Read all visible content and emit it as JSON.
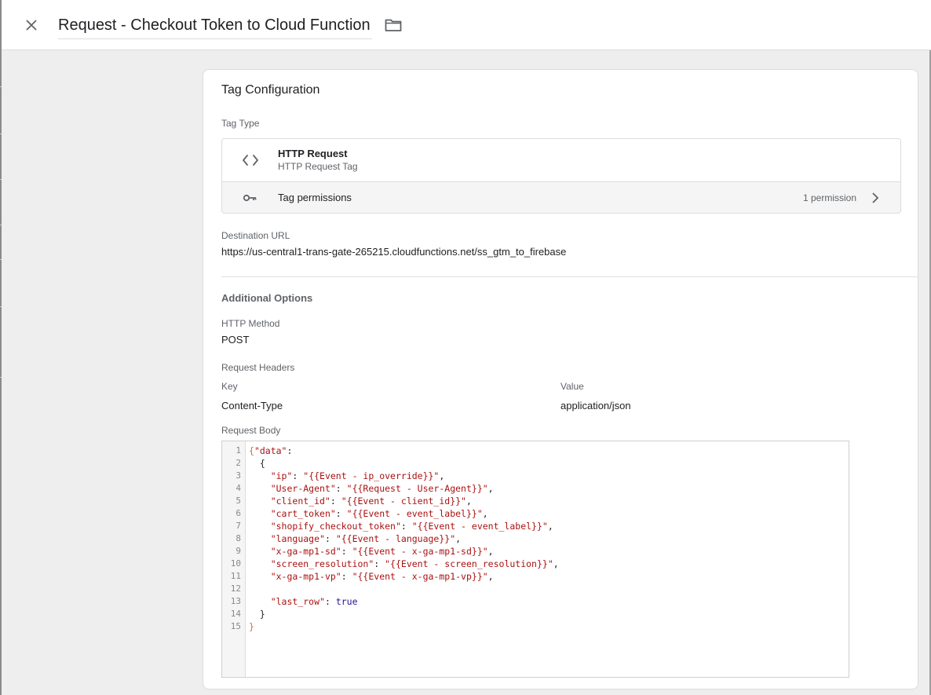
{
  "header": {
    "title": "Request - Checkout Token to Cloud Function"
  },
  "card": {
    "title": "Tag Configuration",
    "tag_type_label": "Tag Type",
    "tag_name": "HTTP Request",
    "tag_sub": "HTTP Request Tag",
    "permissions_label": "Tag permissions",
    "permissions_count": "1 permission",
    "destination_label": "Destination URL",
    "destination_value": "https://us-central1-trans-gate-265215.cloudfunctions.net/ss_gtm_to_firebase",
    "additional_options": "Additional Options",
    "http_method_label": "HTTP Method",
    "http_method_value": "POST",
    "headers_label": "Request Headers",
    "key_label": "Key",
    "value_label": "Value",
    "header_key": "Content-Type",
    "header_value": "application/json",
    "body_label": "Request Body"
  },
  "editor": {
    "line_numbers": [
      "1",
      "2",
      "3",
      "4",
      "5",
      "6",
      "7",
      "8",
      "9",
      "10",
      "11",
      "12",
      "13",
      "14",
      "15"
    ],
    "lines": [
      {
        "pre": "",
        "key": "\"data\"",
        "sep": ":",
        "val": "",
        "post": "",
        "open": "{"
      },
      {
        "pre": "  {",
        "key": "",
        "sep": "",
        "val": "",
        "post": ""
      },
      {
        "pre": "    ",
        "key": "\"ip\"",
        "sep": ": ",
        "val": "\"{{Event - ip_override}}\"",
        "post": ","
      },
      {
        "pre": "    ",
        "key": "\"User-Agent\"",
        "sep": ": ",
        "val": "\"{{Request - User-Agent}}\"",
        "post": ","
      },
      {
        "pre": "    ",
        "key": "\"client_id\"",
        "sep": ": ",
        "val": "\"{{Event - client_id}}\"",
        "post": ","
      },
      {
        "pre": "    ",
        "key": "\"cart_token\"",
        "sep": ": ",
        "val": "\"{{Event - event_label}}\"",
        "post": ","
      },
      {
        "pre": "    ",
        "key": "\"shopify_checkout_token\"",
        "sep": ": ",
        "val": "\"{{Event - event_label}}\"",
        "post": ","
      },
      {
        "pre": "    ",
        "key": "\"language\"",
        "sep": ": ",
        "val": "\"{{Event - language}}\"",
        "post": ","
      },
      {
        "pre": "    ",
        "key": "\"x-ga-mp1-sd\"",
        "sep": ": ",
        "val": "\"{{Event - x-ga-mp1-sd}}\"",
        "post": ","
      },
      {
        "pre": "    ",
        "key": "\"screen_resolution\"",
        "sep": ": ",
        "val": "\"{{Event - screen_resolution}}\"",
        "post": ","
      },
      {
        "pre": "    ",
        "key": "\"x-ga-mp1-vp\"",
        "sep": ": ",
        "val": "\"{{Event - x-ga-mp1-vp}}\"",
        "post": ","
      },
      {
        "pre": "",
        "key": "",
        "sep": "",
        "val": "",
        "post": ""
      },
      {
        "pre": "    ",
        "key": "\"last_row\"",
        "sep": ": ",
        "kw": "true",
        "post": ""
      },
      {
        "pre": "  }",
        "key": "",
        "sep": "",
        "val": "",
        "post": ""
      },
      {
        "pre": "",
        "key": "",
        "sep": "",
        "val": "",
        "post": "",
        "close": "}"
      }
    ]
  }
}
